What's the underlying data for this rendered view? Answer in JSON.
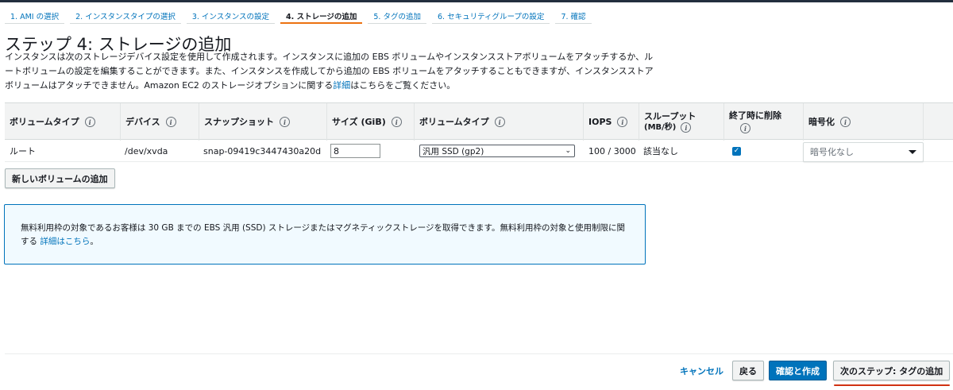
{
  "steps": [
    {
      "label": "1. AMI の選択",
      "active": false
    },
    {
      "label": "2. インスタンスタイプの選択",
      "active": false
    },
    {
      "label": "3. インスタンスの設定",
      "active": false
    },
    {
      "label": "4. ストレージの追加",
      "active": true
    },
    {
      "label": "5. タグの追加",
      "active": false
    },
    {
      "label": "6. セキュリティグループの設定",
      "active": false
    },
    {
      "label": "7. 確認",
      "active": false
    }
  ],
  "page": {
    "title": "ステップ 4: ストレージの追加",
    "description": "インスタンスは次のストレージデバイス設定を使用して作成されます。インスタンスに追加の EBS ボリュームやインスタンスストアボリュームをアタッチするか、ルートボリュームの設定を編集することができます。また、インスタンスを作成してから追加の EBS ボリュームをアタッチすることもできますが、インスタンスストアボリュームはアタッチできません。Amazon EC2 のストレージオプションに関する",
    "description_link": "詳細",
    "description_end": "はこちらをご覧ください。"
  },
  "table": {
    "headers": {
      "volume_type": "ボリュームタイプ",
      "device": "デバイス",
      "snapshot": "スナップショット",
      "size": "サイズ (GiB)",
      "volume_kind": "ボリュームタイプ",
      "iops": "IOPS",
      "throughput": "スループット",
      "throughput_unit": "(MB/秒)",
      "delete_on_termination": "終了時に削除",
      "encryption": "暗号化"
    },
    "row": {
      "volume_type": "ルート",
      "device": "/dev/xvda",
      "snapshot": "snap-09419c3447430a20d",
      "size": "8",
      "volume_kind": "汎用 SSD (gp2)",
      "iops": "100 / 3000",
      "throughput": "該当なし",
      "delete_on_termination": true,
      "encryption": "暗号化なし"
    }
  },
  "add_volume_button": "新しいボリュームの追加",
  "notice": {
    "text": "無料利用枠の対象であるお客様は 30 GB までの EBS 汎用 (SSD) ストレージまたはマグネティックストレージを取得できます。無料利用枠の対象と使用制限に関する",
    "link": "詳細はこちら",
    "end": "。"
  },
  "footer": {
    "cancel": "キャンセル",
    "back": "戻る",
    "review": "確認と作成",
    "next": "次のステップ: タグの追加"
  },
  "colors": {
    "link": "#0073bb",
    "active_step": "#ec7211",
    "primary_button": "#0073bb",
    "highlight_underline": "#d13212"
  }
}
